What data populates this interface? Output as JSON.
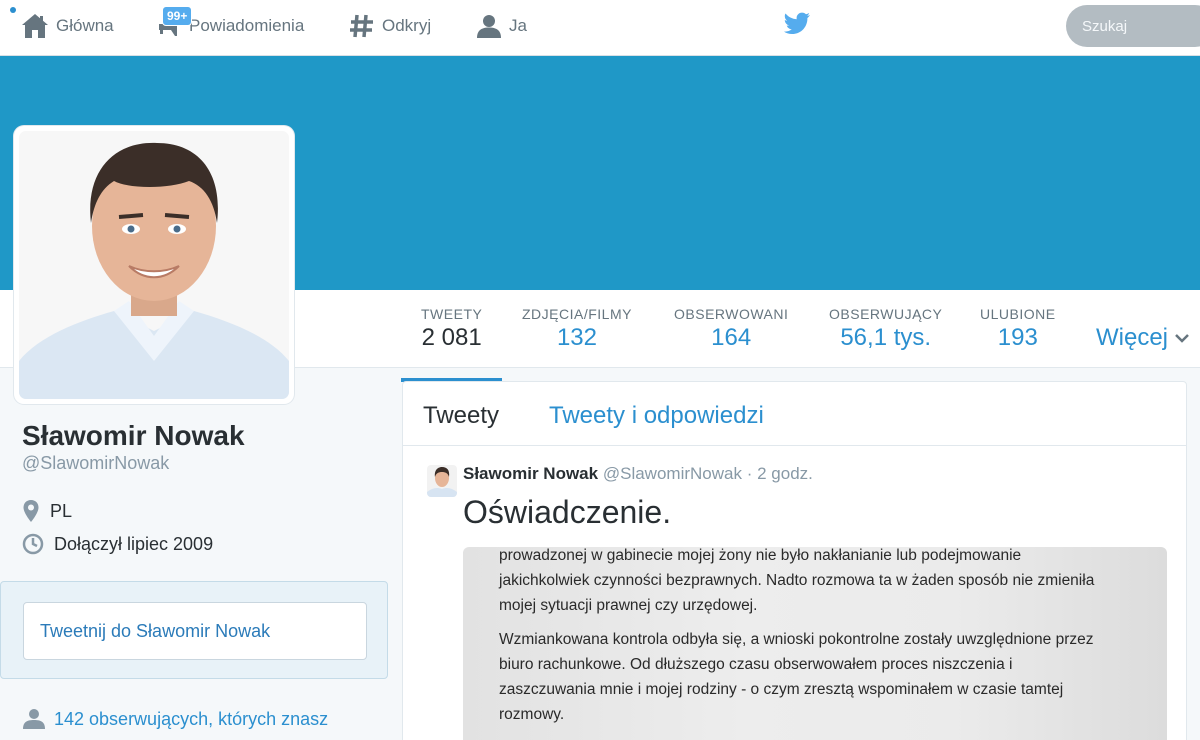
{
  "nav": {
    "home_label": "Główna",
    "notifications_label": "Powiadomienia",
    "notifications_badge": "99+",
    "discover_label": "Odkryj",
    "me_label": "Ja",
    "search_placeholder": "Szukaj"
  },
  "profile": {
    "name": "Sławomir Nowak",
    "handle": "@SlawomirNowak",
    "location": "PL",
    "joined": "Dołączył lipiec 2009",
    "tweet_to": "Tweetnij do Sławomir Nowak",
    "followers_you_know": "142 obserwujących, których znasz"
  },
  "stats": [
    {
      "label": "TWEETY",
      "value": "2 081"
    },
    {
      "label": "ZDJĘCIA/FILMY",
      "value": "132"
    },
    {
      "label": "OBSERWOWANI",
      "value": "164"
    },
    {
      "label": "OBSERWUJĄCY",
      "value": "56,1 tys."
    },
    {
      "label": "ULUBIONE",
      "value": "193"
    }
  ],
  "more_label": "Więcej",
  "timeline": {
    "tabs": [
      "Tweety",
      "Tweety i odpowiedzi"
    ],
    "tweet": {
      "author": "Sławomir Nowak",
      "handle": "@SlawomirNowak",
      "separator": "·",
      "time": "2 godz.",
      "text": "Oświadczenie.",
      "image_lines": [
        "prowadzonej w gabinecie mojej żony nie było nakłanianie lub podejmowanie",
        "jakichkolwiek czynności bezprawnych. Nadto rozmowa ta w żaden sposób nie zmieniła",
        "mojej sytuacji prawnej czy urzędowej.",
        "Wzmiankowana kontrola odbyła się, a wnioski pokontrolne zostały uwzględnione przez",
        "biuro rachunkowe. Od dłuższego czasu obserwowałem proces niszczenia i",
        "zaszczuwania mnie i mojej rodziny - o czym zresztą wspominałem w czasie tamtej",
        "rozmowy."
      ]
    }
  },
  "colors": {
    "banner": "#1f98c7",
    "accent": "#2b8fcf",
    "badge": "#55acee"
  },
  "icons": [
    "home-icon",
    "notifications-icon",
    "hashtag-icon",
    "person-icon",
    "twitter-bird-icon",
    "location-pin-icon",
    "clock-icon",
    "chevron-down-icon",
    "followers-icon"
  ]
}
